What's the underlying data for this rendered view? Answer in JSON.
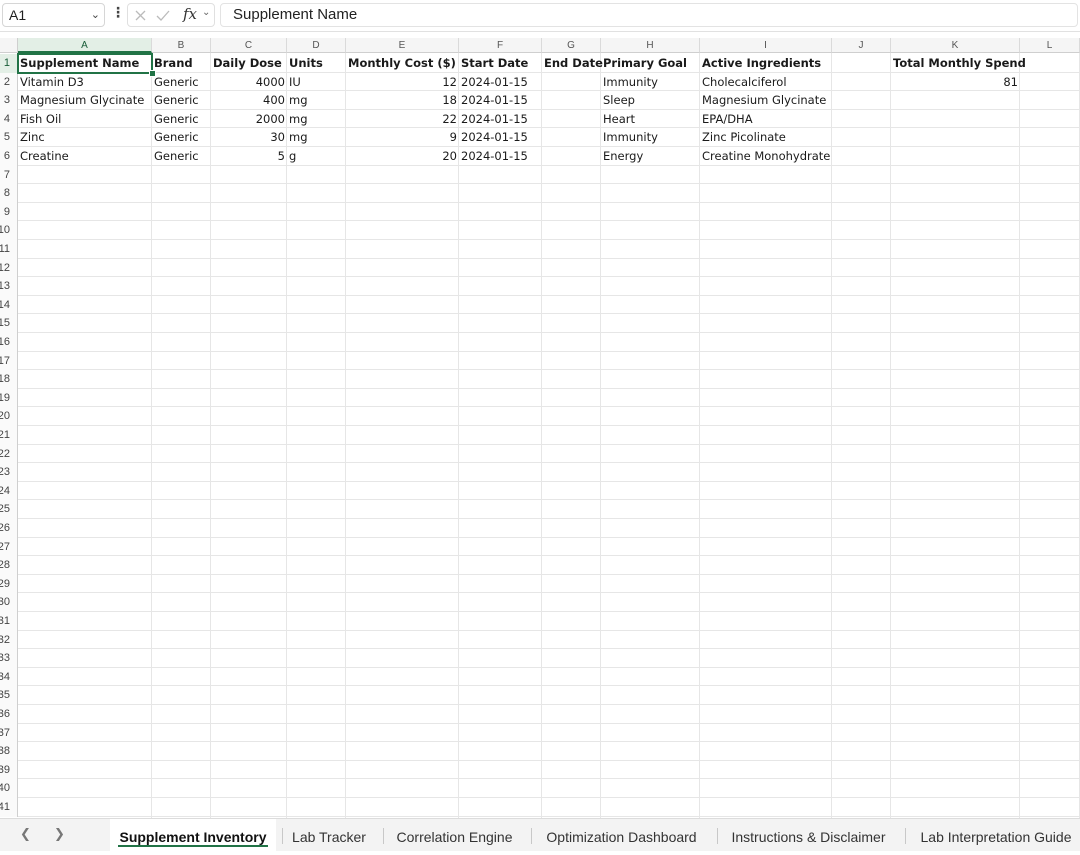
{
  "formula_bar": {
    "name_box": "A1",
    "fx_label": "fx",
    "formula": "Supplement Name"
  },
  "columns": [
    "A",
    "B",
    "C",
    "D",
    "E",
    "F",
    "G",
    "H",
    "I",
    "J",
    "K",
    "L"
  ],
  "row_numbers": [
    "1",
    "2",
    "3",
    "4",
    "5",
    "6",
    "7",
    "8",
    "9",
    "10",
    "11",
    "12",
    "13",
    "14",
    "15",
    "16",
    "17",
    "18",
    "19",
    "20",
    "21",
    "22",
    "23",
    "24",
    "25",
    "26",
    "27",
    "28",
    "29",
    "30",
    "31",
    "32",
    "33",
    "34",
    "35",
    "36",
    "37",
    "38",
    "39",
    "40",
    "41"
  ],
  "headers": {
    "A": "Supplement Name",
    "B": "Brand",
    "C": "Daily Dose",
    "D": "Units",
    "E": "Monthly Cost ($)",
    "F": "Start Date",
    "G": "End Date",
    "H": "Primary Goal",
    "I": "Active Ingredients",
    "K": "Total Monthly Spend"
  },
  "rows": [
    {
      "name": "Vitamin D3",
      "brand": "Generic",
      "dose": "4000",
      "units": "IU",
      "cost": "12",
      "start": "2024-01-15",
      "end": "",
      "goal": "Immunity",
      "ingredients": "Cholecalciferol"
    },
    {
      "name": "Magnesium Glycinate",
      "brand": "Generic",
      "dose": "400",
      "units": "mg",
      "cost": "18",
      "start": "2024-01-15",
      "end": "",
      "goal": "Sleep",
      "ingredients": "Magnesium Glycinate"
    },
    {
      "name": "Fish Oil",
      "brand": "Generic",
      "dose": "2000",
      "units": "mg",
      "cost": "22",
      "start": "2024-01-15",
      "end": "",
      "goal": "Heart",
      "ingredients": "EPA/DHA"
    },
    {
      "name": "Zinc",
      "brand": "Generic",
      "dose": "30",
      "units": "mg",
      "cost": "9",
      "start": "2024-01-15",
      "end": "",
      "goal": "Immunity",
      "ingredients": "Zinc Picolinate"
    },
    {
      "name": "Creatine",
      "brand": "Generic",
      "dose": "5",
      "units": "g",
      "cost": "20",
      "start": "2024-01-15",
      "end": "",
      "goal": "Energy",
      "ingredients": "Creatine Monohydrate"
    }
  ],
  "total_monthly_spend": "81",
  "sheet_tabs": [
    {
      "label": "Supplement Inventory",
      "active": true
    },
    {
      "label": "Lab Tracker",
      "active": false
    },
    {
      "label": "Correlation Engine",
      "active": false
    },
    {
      "label": "Optimization Dashboard",
      "active": false
    },
    {
      "label": "Instructions & Disclaimer",
      "active": false
    },
    {
      "label": "Lab Interpretation Guide",
      "active": false
    }
  ],
  "colors": {
    "accent": "#217346",
    "gridline": "#e6e6e6"
  }
}
